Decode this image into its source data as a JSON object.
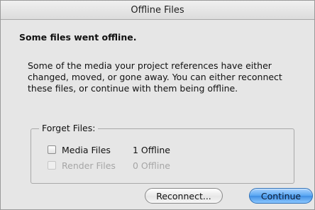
{
  "window": {
    "title": "Offline Files"
  },
  "dialog": {
    "heading": "Some files went offline.",
    "message_lines": [
      "Some of the media your project references have either",
      "changed, moved, or gone away. You can either reconnect",
      "these files, or continue with them being offline."
    ]
  },
  "forget_files": {
    "label": "Forget Files:",
    "items": [
      {
        "name": "Media Files",
        "status": "1 Offline",
        "checked": false,
        "enabled": true
      },
      {
        "name": "Render Files",
        "status": "0 Offline",
        "checked": false,
        "enabled": false
      }
    ]
  },
  "buttons": {
    "reconnect_label": "Reconnect...",
    "continue_label": "Continue"
  }
}
